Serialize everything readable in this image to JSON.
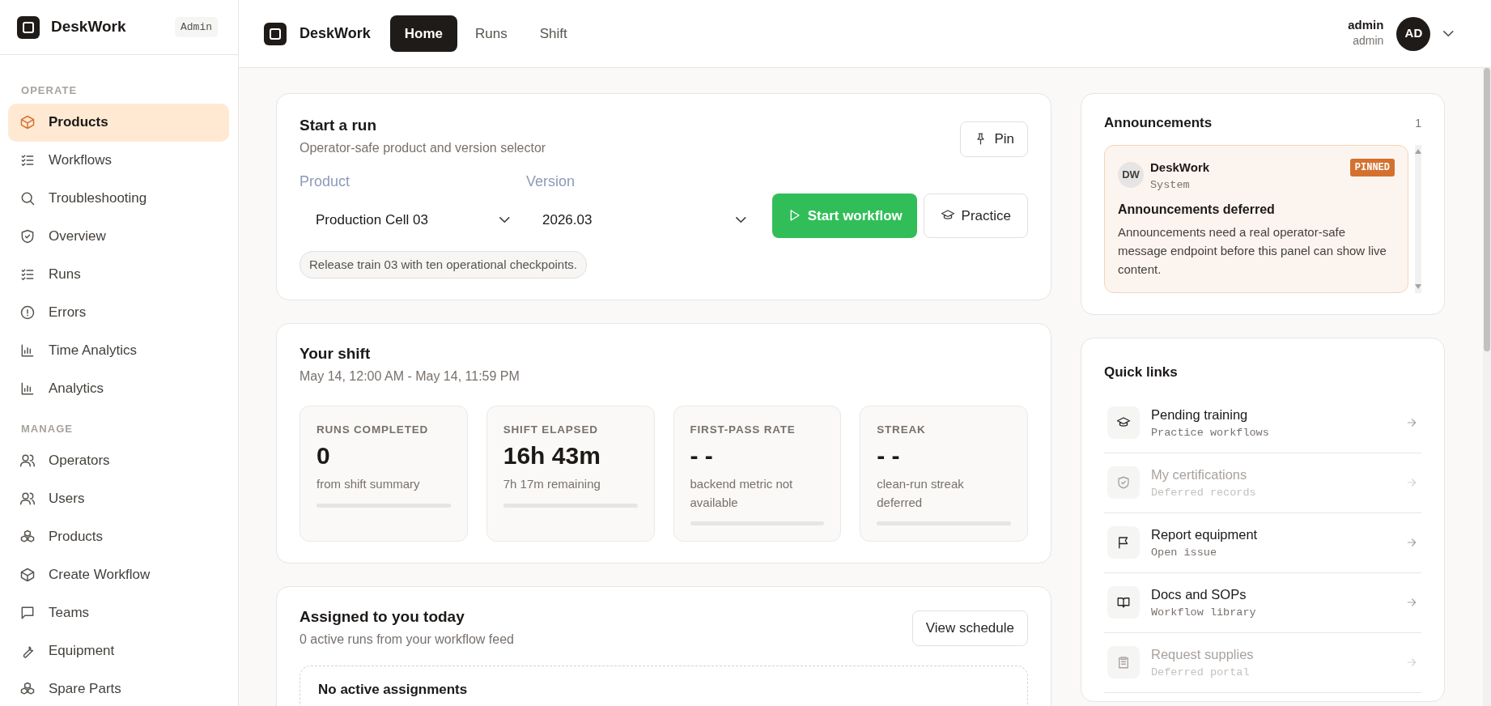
{
  "sidebar": {
    "brand": "DeskWork",
    "badge": "Admin",
    "sections": [
      {
        "title": "OPERATE",
        "items": [
          {
            "label": "Products",
            "selected": true
          },
          {
            "label": "Workflows",
            "selected": false
          },
          {
            "label": "Troubleshooting",
            "selected": false
          },
          {
            "label": "Overview",
            "selected": false
          },
          {
            "label": "Runs",
            "selected": false
          },
          {
            "label": "Errors",
            "selected": false
          },
          {
            "label": "Time Analytics",
            "selected": false
          },
          {
            "label": "Analytics",
            "selected": false
          }
        ]
      },
      {
        "title": "MANAGE",
        "items": [
          {
            "label": "Operators",
            "selected": false
          },
          {
            "label": "Users",
            "selected": false
          },
          {
            "label": "Products",
            "selected": false
          },
          {
            "label": "Create Workflow",
            "selected": false
          },
          {
            "label": "Teams",
            "selected": false
          },
          {
            "label": "Equipment",
            "selected": false
          },
          {
            "label": "Spare Parts",
            "selected": false
          }
        ]
      }
    ]
  },
  "topbar": {
    "brand": "DeskWork",
    "tabs": [
      {
        "label": "Home",
        "selected": true
      },
      {
        "label": "Runs",
        "selected": false
      },
      {
        "label": "Shift",
        "selected": false
      }
    ],
    "user": {
      "name": "admin",
      "role": "admin",
      "initials": "AD"
    }
  },
  "start_run": {
    "title": "Start a run",
    "subtitle": "Operator-safe product and version selector",
    "pin_button": "Pin",
    "product": {
      "label": "Product",
      "value": "Production Cell 03"
    },
    "version": {
      "label": "Version",
      "value": "2026.03"
    },
    "start_button": "Start workflow",
    "practice_button": "Practice",
    "note": "Release train 03 with ten operational checkpoints."
  },
  "shift": {
    "title": "Your shift",
    "range": "May 14, 12:00 AM - May 14, 11:59 PM",
    "metrics": [
      {
        "label": "RUNS COMPLETED",
        "value": "0",
        "caption": "from shift summary"
      },
      {
        "label": "SHIFT ELAPSED",
        "value": "16h 43m",
        "caption": "7h 17m remaining"
      },
      {
        "label": "FIRST-PASS RATE",
        "value": "- -",
        "caption": "backend metric not available"
      },
      {
        "label": "STREAK",
        "value": "- -",
        "caption": "clean-run streak deferred"
      }
    ]
  },
  "assigned": {
    "title": "Assigned to you today",
    "subtitle": "0 active runs from your workflow feed",
    "button": "View schedule",
    "empty_title": "No active assignments"
  },
  "announcements": {
    "title": "Announcements",
    "count": "1",
    "items": [
      {
        "avatar": "DW",
        "author": "DeskWork",
        "role": "System",
        "badge": "PINNED",
        "pinned": true,
        "title": "Announcements deferred",
        "body": "Announcements need a real operator-safe message endpoint before this panel can show live content."
      }
    ]
  },
  "quick_links": {
    "title": "Quick links",
    "items": [
      {
        "title": "Pending training",
        "subtitle": "Practice workflows",
        "disabled": false
      },
      {
        "title": "My certifications",
        "subtitle": "Deferred records",
        "disabled": true
      },
      {
        "title": "Report equipment",
        "subtitle": "Open issue",
        "disabled": false
      },
      {
        "title": "Docs and SOPs",
        "subtitle": "Workflow library",
        "disabled": false
      },
      {
        "title": "Request supplies",
        "subtitle": "Deferred portal",
        "disabled": true
      }
    ]
  }
}
